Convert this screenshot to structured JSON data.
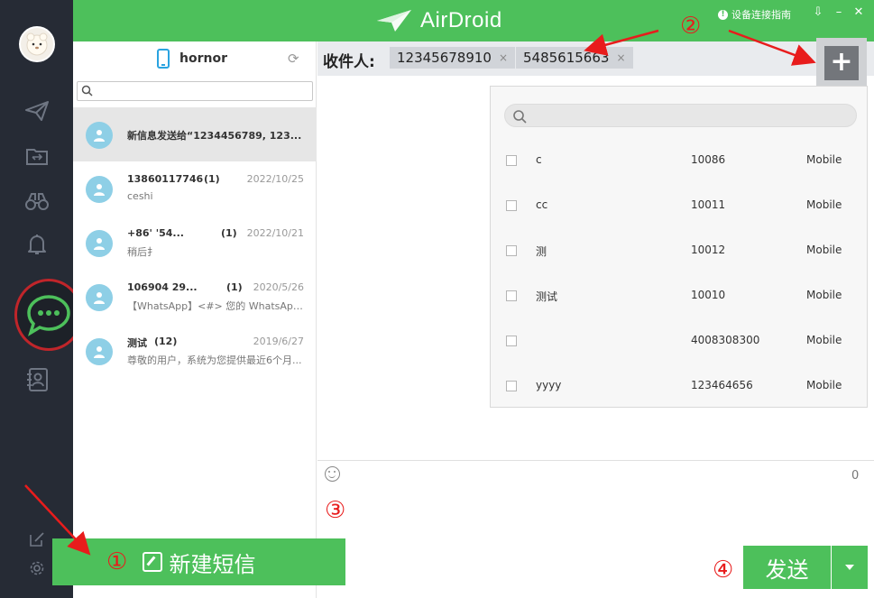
{
  "app": {
    "title": "AirDroid"
  },
  "topbar": {
    "guide_label": "设备连接指南",
    "minimize": "–",
    "close": "✕",
    "collapse": "⇩"
  },
  "device": {
    "name": "hornor"
  },
  "search": {
    "placeholder": ""
  },
  "conversations": [
    {
      "name": "新信息发送给“1234456789, 123...",
      "count": "",
      "date": "",
      "preview": ""
    },
    {
      "name": "13860117746",
      "count": "(1)",
      "date": "2022/10/25",
      "preview": "ceshi"
    },
    {
      "name": "+86'  '54...",
      "count": "(1)",
      "date": "2022/10/21",
      "preview": "稍后扌"
    },
    {
      "name": "106904       29...",
      "count": "(1)",
      "date": "2020/5/26",
      "preview": "【WhatsApp】<#> 您的 WhatsApp ..."
    },
    {
      "name": "测试",
      "count": "(12)",
      "date": "2019/6/27",
      "preview": "尊敬的用户，系统为您提供最近6个月..."
    }
  ],
  "recipients": {
    "label": "收件人:",
    "chips": [
      "12345678910",
      "5485615663"
    ],
    "remove_glyph": "×"
  },
  "contacts": [
    {
      "name": "c",
      "number": "10086",
      "type": "Mobile"
    },
    {
      "name": "cc",
      "number": "10011",
      "type": "Mobile"
    },
    {
      "name": "测",
      "number": "10012",
      "type": "Mobile"
    },
    {
      "name": "测试",
      "number": "10010",
      "type": "Mobile"
    },
    {
      "name": "",
      "number": "4008308300",
      "type": "Mobile"
    },
    {
      "name": "yyyy",
      "number": "123464656",
      "type": "Mobile"
    }
  ],
  "compose": {
    "char_count": "0",
    "send_label": "发送"
  },
  "new_message": {
    "label": "新建短信"
  },
  "annotations": {
    "a1": "①",
    "a2": "②",
    "a3": "③",
    "a4": "④"
  },
  "colors": {
    "brand_green": "#4dc05b",
    "rail": "#262b35",
    "annotation_red": "#e81c1c",
    "avatar_blue": "#8ecfe6"
  },
  "icons": [
    "send-icon",
    "folder-transfer-icon",
    "binoculars-icon",
    "bell-icon",
    "chat-bubble-icon",
    "contacts-icon",
    "edit-icon",
    "gear-icon",
    "refresh-icon",
    "search-icon",
    "plus-icon",
    "emoji-icon"
  ]
}
